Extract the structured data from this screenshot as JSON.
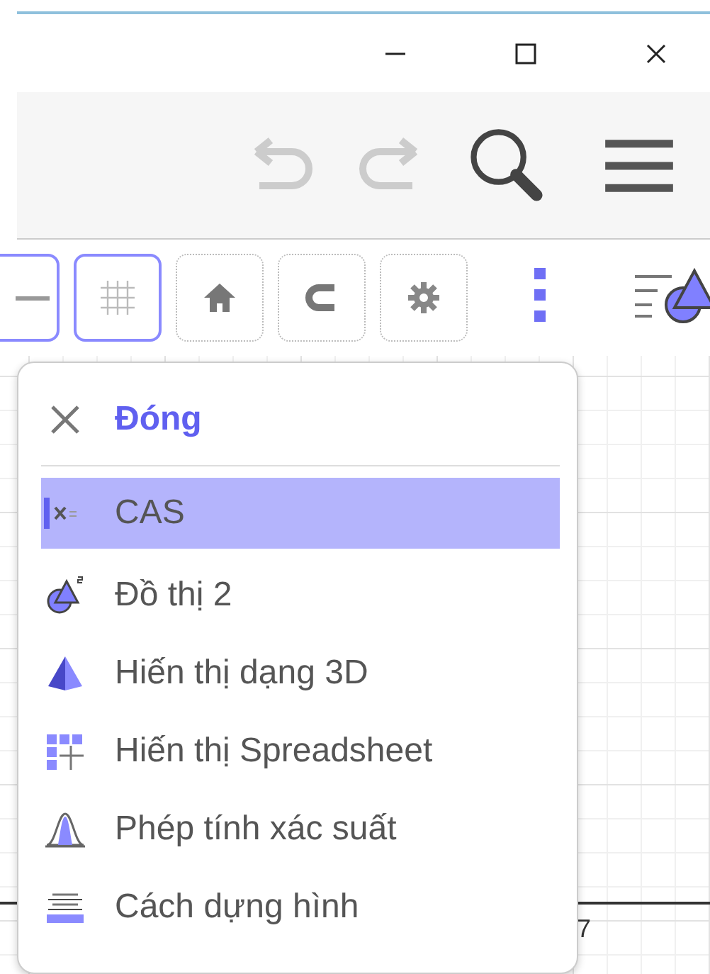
{
  "window_controls": [
    {
      "kind": "minimize"
    },
    {
      "kind": "maximize"
    },
    {
      "kind": "close"
    }
  ],
  "toolbar": {
    "undo": {
      "disabled": true
    },
    "redo": {
      "disabled": true
    }
  },
  "style_bar": [
    {
      "kind": "line",
      "selected": true
    },
    {
      "kind": "grid",
      "selected": true
    },
    {
      "kind": "home",
      "selected": false
    },
    {
      "kind": "magnet",
      "selected": false
    },
    {
      "kind": "gear",
      "selected": false
    }
  ],
  "menu": {
    "close_label": "Đóng",
    "items": [
      {
        "kind": "cas",
        "label": "CAS",
        "selected": true
      },
      {
        "kind": "graphics2",
        "label": "Đồ thị 2",
        "selected": false
      },
      {
        "kind": "pyramid",
        "label": "Hiến thị dạng 3D",
        "selected": false
      },
      {
        "kind": "spreadsheet",
        "label": "Hiến thị Spreadsheet",
        "selected": false
      },
      {
        "kind": "probability",
        "label": "Phép tính xác suất",
        "selected": false
      },
      {
        "kind": "construction",
        "label": "Cách dựng hình",
        "selected": false
      }
    ]
  },
  "axis_label": "7"
}
